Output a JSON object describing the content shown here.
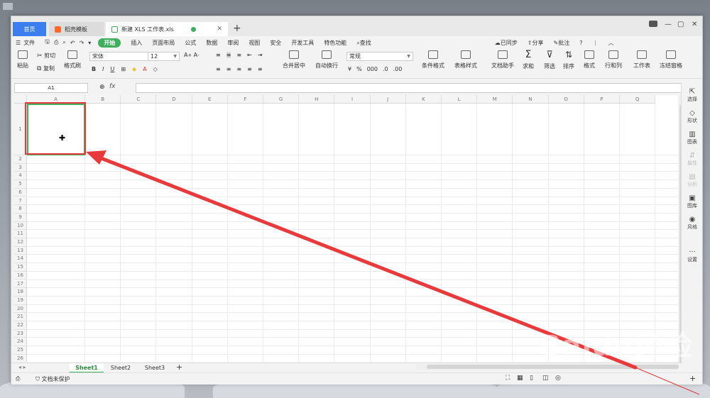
{
  "tabs": {
    "home": "首页",
    "template": "稻壳模板",
    "document": "新建 XLS 工作表.xls",
    "new_tab": "+"
  },
  "menu": {
    "file": "文件",
    "items": [
      "开始",
      "插入",
      "页面布局",
      "公式",
      "数据",
      "审阅",
      "视图",
      "安全",
      "开发工具",
      "特色功能"
    ],
    "search": "查找",
    "sync": "已同步",
    "share": "分享",
    "annotate": "批注"
  },
  "ribbon": {
    "paste": "粘贴",
    "cut": "剪切",
    "copy": "复制",
    "format_painter": "格式刷",
    "font_name": "宋体",
    "font_size": "12",
    "merge_center": "合并居中",
    "wrap_text": "自动换行",
    "number_format": "常规",
    "conditional_format": "条件格式",
    "table_style": "表格样式",
    "doc_assistant": "文档助手",
    "sum": "求和",
    "filter": "筛选",
    "sort": "排序",
    "format": "格式",
    "row_col": "行和列",
    "worksheet": "工作表",
    "freeze_panes": "冻结窗格"
  },
  "formula_bar": {
    "name_box": "A1",
    "fx": "fx"
  },
  "grid": {
    "columns": [
      "A",
      "B",
      "C",
      "D",
      "E",
      "F",
      "G",
      "H",
      "I",
      "J",
      "K",
      "L",
      "M",
      "N",
      "O",
      "P",
      "Q"
    ],
    "rows": [
      "1",
      "2",
      "3",
      "4",
      "5",
      "6",
      "7",
      "8",
      "9",
      "10",
      "11",
      "12",
      "13",
      "14",
      "15",
      "16",
      "17",
      "18",
      "19",
      "20",
      "21",
      "22",
      "23",
      "24",
      "25",
      "26"
    ]
  },
  "right_panel": [
    "选择",
    "形状",
    "图表",
    "属性",
    "分析",
    "图库",
    "风格",
    "设置"
  ],
  "sheets": [
    "Sheet1",
    "Sheet2",
    "Sheet3"
  ],
  "status": {
    "protection": "文档未保护"
  },
  "watermark": "Baidu经验",
  "colors": {
    "accent_green": "#3cae5c",
    "home_tab_blue": "#3a7ef0",
    "annotation_red": "#e83a3a"
  }
}
